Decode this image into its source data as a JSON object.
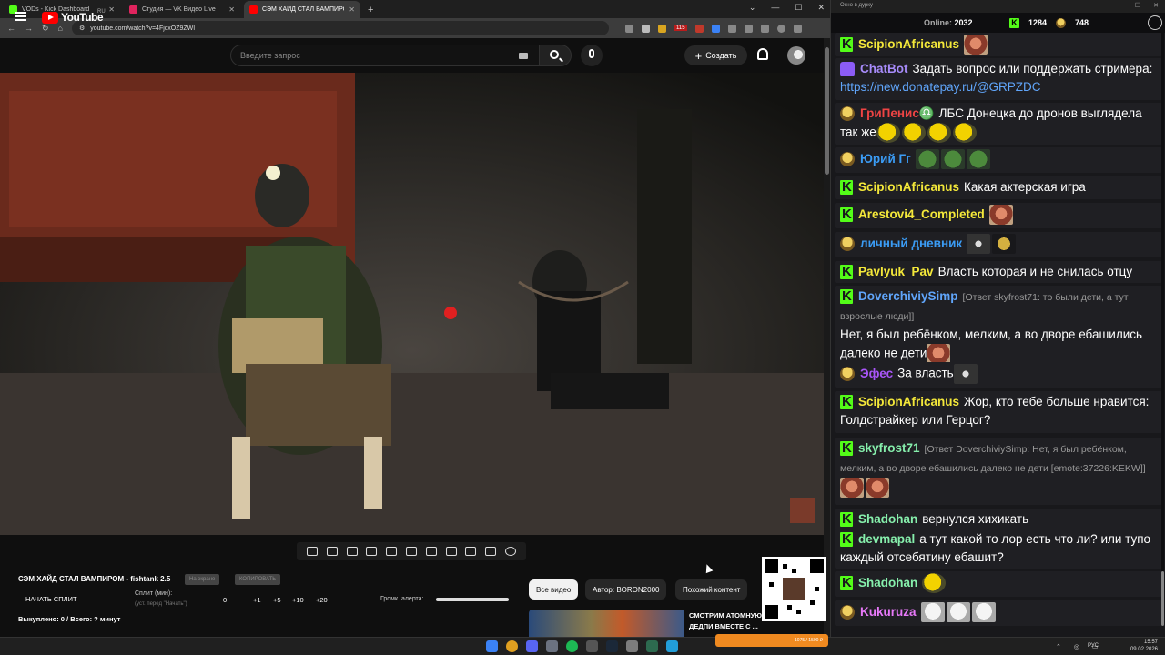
{
  "browser": {
    "tabs": [
      {
        "title": "VODs - Kick Dashboard",
        "color": "#53fc18"
      },
      {
        "title": "Студия — VK Видео Live",
        "color": "#e0245e"
      },
      {
        "title": "СЭМ ХАЙД СТАЛ ВАМПИРОМ",
        "color": "#ff0000"
      }
    ],
    "url": "youtube.com/watch?v=4FjcxOZ9ZWI",
    "ext_badge": "115"
  },
  "youtube": {
    "logo": "YouTube",
    "region": "RU",
    "search_placeholder": "Введите запрос",
    "create_label": "Создать"
  },
  "split_panel": {
    "title": "СЭМ ХАЙД СТАЛ ВАМПИРОМ - fishtank 2.5",
    "badge1": "На экране",
    "badge2": "КОПИРОВАТЬ",
    "start_label": "НАЧАТЬ СПЛИТ",
    "split_label": "Сплит (мин):",
    "split_sub": "(уст. перед \"Начать\")",
    "split_value": "0",
    "increments": [
      "+1",
      "+5",
      "+10",
      "+20"
    ],
    "alert_label": "Громк. алерта:",
    "alert_volume": 1.0,
    "totals": "Выкуплено: 0 / Всего: ? минут"
  },
  "chips": [
    "Все видео",
    "Автор: BORON2000",
    "Похожий контент"
  ],
  "recommendation": {
    "title": "СМОТРИМ АТОМНУЮ БОМБУ ДЕДПИ ВМЕСТЕ С ..."
  },
  "chat": {
    "window_title": "Окно в дурку",
    "online_label": "Online:",
    "online_count": "2032",
    "kick_count": "1284",
    "vk_count": "748",
    "messages": [
      {
        "badge": "kick",
        "user": "ScipionAfricanus",
        "color": "#f4e83a",
        "text": "",
        "emotes": [
          "face"
        ]
      },
      {
        "badge": "bot",
        "user": "ChatBot",
        "color": "#a78bfa",
        "text": "Задать вопрос или поддержать стримера: ",
        "link": "https://new.donatepay.ru/@GRPZDC"
      },
      {
        "badge": "emo",
        "user": "ГриПенис♎",
        "color": "#ef4444",
        "text": "ЛБС Донецка до дронов выглядела так же",
        "emotes": [
          "yellow",
          "yellow",
          "yellow",
          "yellow"
        ]
      },
      {
        "badge": "emo",
        "user": "Юрий Гг",
        "color": "#3b9cf5",
        "text": "",
        "emotes": [
          "pepe",
          "pepe",
          "pepe"
        ]
      },
      {
        "badge": "kick",
        "user": "ScipionAfricanus",
        "color": "#f4e83a",
        "text": "Какая актерская игра"
      },
      {
        "badge": "kick",
        "user": "Arestovi4_Completed",
        "color": "#f4e83a",
        "text": "",
        "emotes": [
          "face"
        ]
      },
      {
        "badge": "emo",
        "user": "личный дневник",
        "color": "#3b9cf5",
        "text": "",
        "emotes": [
          "dark",
          "gold"
        ]
      },
      {
        "badge": "kick",
        "user": "Pavlyuk_Pav",
        "color": "#f4e83a",
        "text": "Власть которая и не снилась отцу"
      },
      {
        "badge": "kick",
        "user": "DoverchiviySimp",
        "color": "#60a5fa",
        "reply": "[Ответ skyfrost71: то были дети, а тут взрослые люди]]",
        "text": "Нет, я был ребёнком, мелким, а во дворе ебашились далеко не дети",
        "emotes": [
          "face"
        ]
      },
      {
        "badge": "emo",
        "user": "Эфес",
        "color": "#a855f7",
        "text": "За власть",
        "emotes": [
          "dark"
        ]
      },
      {
        "badge": "kick",
        "user": "ScipionAfricanus",
        "color": "#f4e83a",
        "text": "Жор, кто тебе больше нравится: Голдстрайкер или Герцог?"
      },
      {
        "badge": "kick",
        "user": "skyfrost71",
        "color": "#86efac",
        "reply": "[Ответ DoverchiviySimp: Нет, я был ребёнком, мелким, а во дворе ебашились далеко не дети [emote:37226:KEKW]]",
        "text": "",
        "emotes": [
          "face",
          "face"
        ]
      },
      {
        "badge": "kick",
        "user": "Shadohan",
        "color": "#86efac",
        "text": "вернулся хихикать"
      },
      {
        "badge": "kick",
        "user": "devmapal",
        "color": "#86efac",
        "text": "а тут какой то лор есть что ли? или тупо каждый отсебятину ебашит?"
      },
      {
        "badge": "kick",
        "user": "Shadohan",
        "color": "#86efac",
        "text": "",
        "emotes": [
          "yellow"
        ]
      },
      {
        "badge": "emo",
        "user": "Kukuruza",
        "color": "#e879f9",
        "text": "",
        "emotes": [
          "cat",
          "cat",
          "cat"
        ]
      }
    ]
  },
  "taskbar": {
    "lang": "РУС",
    "time": "15:57",
    "date": "09.02.2026",
    "donate_text": "1075 / 1500 ₽"
  }
}
